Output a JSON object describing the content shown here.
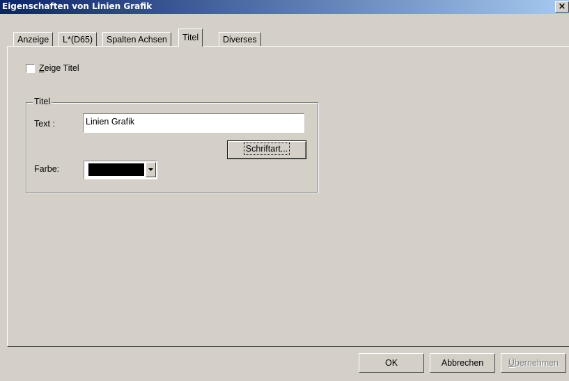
{
  "window": {
    "title": "Eigenschaften von Linien Grafik",
    "close_icon": "close-icon"
  },
  "tabs": [
    {
      "label": "Anzeige",
      "active": false
    },
    {
      "label": "L*(D65)",
      "active": false
    },
    {
      "label": "Spalten Achsen",
      "active": false
    },
    {
      "label": "Titel",
      "active": true
    },
    {
      "label": "Diverses",
      "active": false
    }
  ],
  "show_title": {
    "label_underlined": "Z",
    "label_rest": "eige Titel",
    "checked": false
  },
  "title_group": {
    "legend": "Titel",
    "text_label": "Text :",
    "text_value": "Linien Grafik",
    "font_button": "Schriftart...",
    "color_label": "Farbe:",
    "color_value": "#000000"
  },
  "buttons": {
    "ok": "OK",
    "cancel": "Abbrechen",
    "apply_underlined": "Ü",
    "apply_rest": "bernehmen"
  }
}
